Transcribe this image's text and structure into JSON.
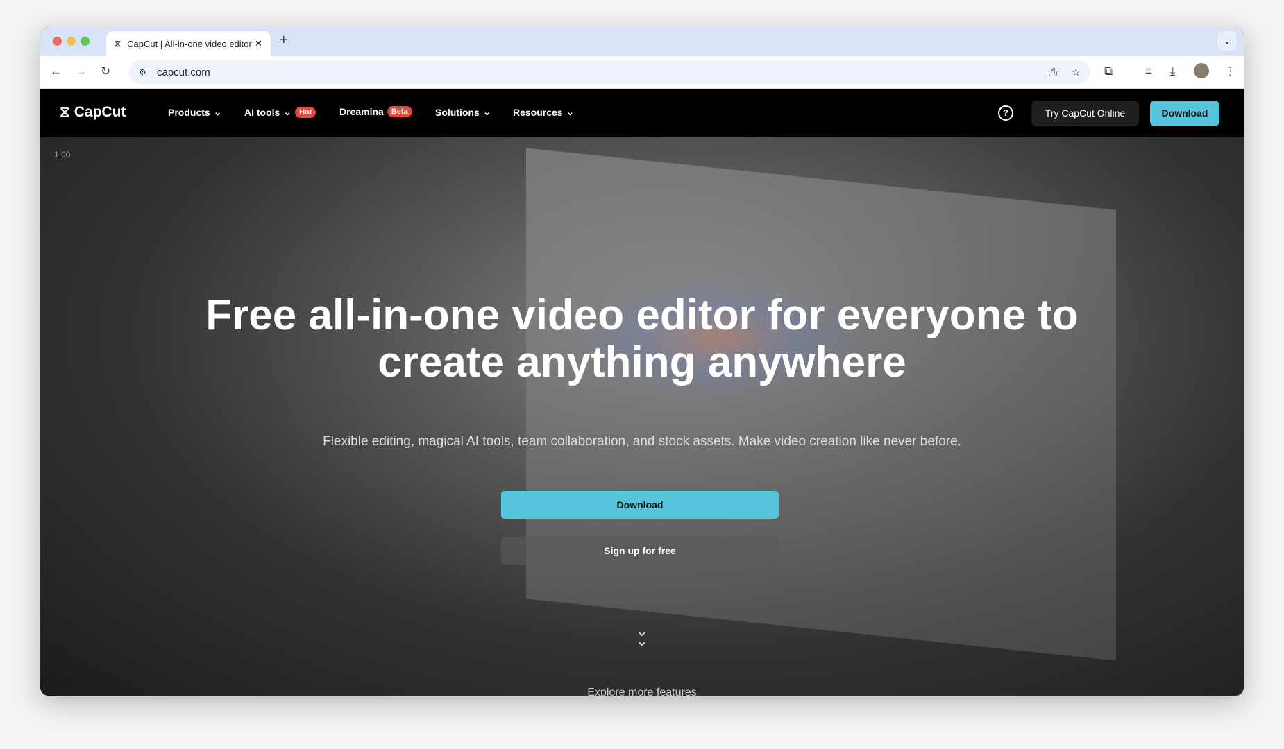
{
  "browser": {
    "tab_title": "CapCut | All-in-one video editor",
    "url": "capcut.com"
  },
  "nav": {
    "logo": "CapCut",
    "items": [
      {
        "label": "Products"
      },
      {
        "label": "AI tools",
        "badge": "Hot"
      },
      {
        "label": "Dreamina",
        "badge": "Beta"
      },
      {
        "label": "Solutions"
      },
      {
        "label": "Resources"
      }
    ],
    "try_online": "Try CapCut Online",
    "download": "Download"
  },
  "hero": {
    "ratio": "1.00",
    "title_line1": "Free all-in-one video editor for everyone to",
    "title_line2": "create anything anywhere",
    "subtitle": "Flexible editing, magical AI tools, team collaboration, and stock assets. Make video creation like never before.",
    "download": "Download",
    "signup": "Sign up for free",
    "explore": "Explore more features"
  },
  "colors": {
    "accent": "#56c5dc",
    "badge": "#e5483f"
  }
}
